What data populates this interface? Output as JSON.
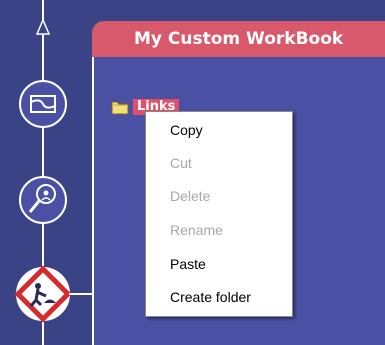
{
  "title_bar": {
    "title": "My Custom WorkBook"
  },
  "folder": {
    "label": "Links",
    "icon": "folder-icon"
  },
  "sidebar": {
    "icons": [
      "arrow-up-icon",
      "curve-tool-icon",
      "search-person-icon",
      "construction-sign-icon"
    ]
  },
  "context_menu": {
    "items": [
      {
        "label": "Copy",
        "enabled": true
      },
      {
        "label": "Cut",
        "enabled": false
      },
      {
        "label": "Delete",
        "enabled": false
      },
      {
        "label": "Rename",
        "enabled": false
      },
      {
        "label": "Paste",
        "enabled": true
      },
      {
        "label": "Create folder",
        "enabled": true
      }
    ]
  },
  "colors": {
    "background": "#3a4386",
    "title_bar": "#d9596c",
    "canvas": "#4a51a4",
    "menu_bg": "#ffffff",
    "disabled_text": "#a8a8a8"
  }
}
